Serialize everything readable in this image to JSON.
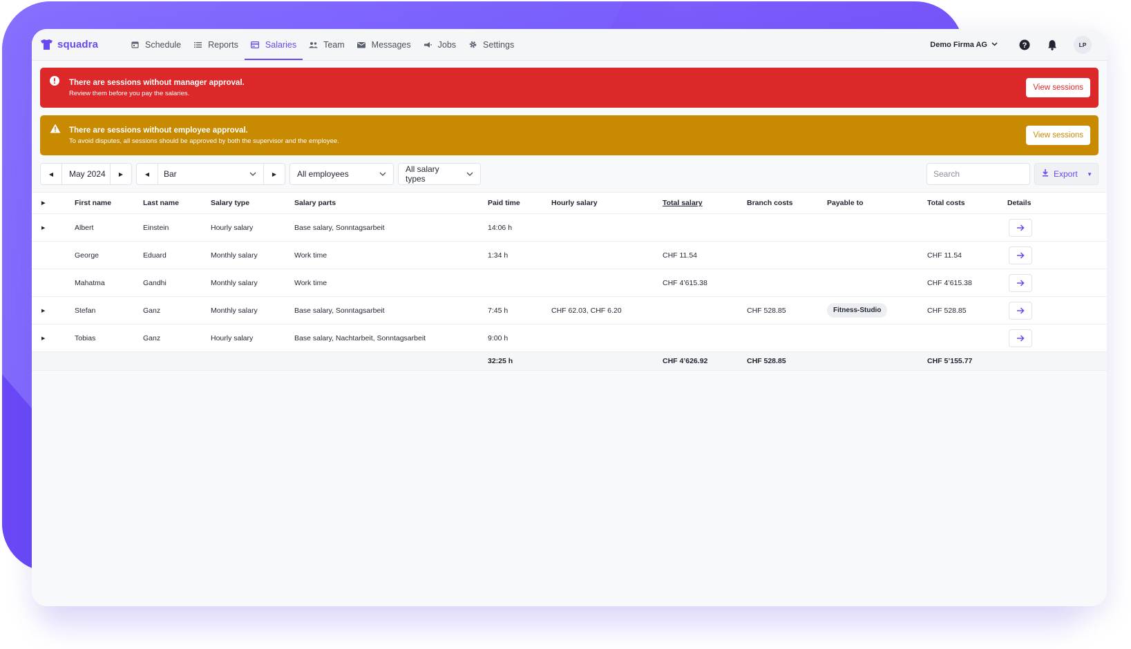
{
  "nav": {
    "brand": "squadra",
    "items": [
      {
        "label": "Schedule",
        "icon": "calendar-icon",
        "active": false
      },
      {
        "label": "Reports",
        "icon": "list-icon",
        "active": false
      },
      {
        "label": "Salaries",
        "icon": "card-icon",
        "active": true
      },
      {
        "label": "Team",
        "icon": "team-icon",
        "active": false
      },
      {
        "label": "Messages",
        "icon": "mail-icon",
        "active": false
      },
      {
        "label": "Jobs",
        "icon": "megaphone-icon",
        "active": false
      },
      {
        "label": "Settings",
        "icon": "gear-icon",
        "active": false
      }
    ],
    "company": "Demo Firma AG",
    "avatar_initials": "LP"
  },
  "alerts": {
    "manager": {
      "title": "There are sessions without manager approval.",
      "subtitle": "Review them before you pay the salaries.",
      "button": "View sessions"
    },
    "employee": {
      "title": "There are sessions without employee approval.",
      "subtitle": "To avoid disputes, all sessions should be approved by both the supervisor and the employee.",
      "button": "View sessions"
    }
  },
  "filters": {
    "month": "May 2024",
    "branch": "Bar",
    "employees": "All employees",
    "salary_types": "All salary types",
    "search_placeholder": "Search",
    "export_label": "Export"
  },
  "table": {
    "headers": {
      "first": "First name",
      "last": "Last name",
      "stype": "Salary type",
      "parts": "Salary parts",
      "paid": "Paid time",
      "hourly": "Hourly salary",
      "total": "Total salary",
      "branch": "Branch costs",
      "pay": "Payable to",
      "tcost": "Total costs",
      "details": "Details"
    },
    "rows": [
      {
        "first": "Albert",
        "last": "Einstein",
        "stype": "Hourly salary",
        "parts": "Base salary, Sonntagsarbeit",
        "paid": "14:06 h",
        "hourly": "",
        "total": "",
        "branch": "",
        "pay": "",
        "tcost": ""
      },
      {
        "first": "George",
        "last": "Eduard",
        "stype": "Monthly salary",
        "parts": "Work time",
        "paid": "1:34 h",
        "hourly": "",
        "total": "CHF 11.54",
        "branch": "",
        "pay": "",
        "tcost": "CHF 11.54"
      },
      {
        "first": "Mahatma",
        "last": "Gandhi",
        "stype": "Monthly salary",
        "parts": "Work time",
        "paid": "",
        "hourly": "",
        "total": "CHF 4’615.38",
        "branch": "",
        "pay": "",
        "tcost": "CHF 4’615.38"
      },
      {
        "first": "Stefan",
        "last": "Ganz",
        "stype": "Monthly salary",
        "parts": "Base salary, Sonntagsarbeit",
        "paid": "7:45 h",
        "hourly": "CHF 62.03, CHF 6.20",
        "total": "",
        "branch": "CHF 528.85",
        "pay": "Fitness-Studio",
        "tcost": "CHF 528.85"
      },
      {
        "first": "Tobias",
        "last": "Ganz",
        "stype": "Hourly salary",
        "parts": "Base salary, Nachtarbeit, Sonntagsarbeit",
        "paid": "9:00 h",
        "hourly": "",
        "total": "",
        "branch": "",
        "pay": "",
        "tcost": ""
      }
    ],
    "totals": {
      "paid": "32:25 h",
      "total": "CHF 4’626.92",
      "branch": "CHF 528.85",
      "tcost": "CHF 5’155.77"
    }
  },
  "colors": {
    "brand": "#6848f2",
    "alert_red": "#dc2828",
    "alert_yellow": "#c78a00"
  }
}
